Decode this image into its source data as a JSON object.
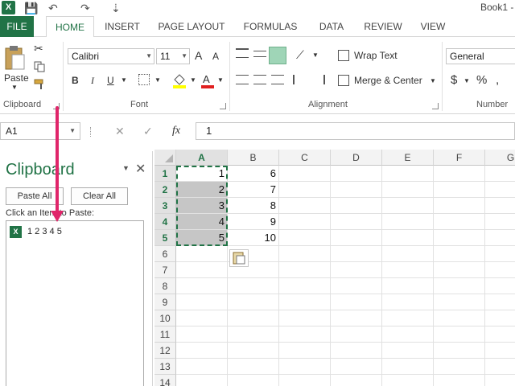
{
  "title_bar": {
    "book_title": "Book1 -",
    "qa_save": "💾",
    "qa_undo": "↶",
    "qa_redo": "↷",
    "qa_more": "⇣"
  },
  "tabs": [
    "FILE",
    "HOME",
    "INSERT",
    "PAGE LAYOUT",
    "FORMULAS",
    "DATA",
    "REVIEW",
    "VIEW"
  ],
  "clipboard_group": {
    "paste_label": "Paste",
    "group_label": "Clipboard"
  },
  "font_group": {
    "font_name": "Calibri",
    "font_size": "11",
    "bold": "B",
    "italic": "I",
    "underline": "U",
    "group_label": "Font",
    "grow": "A",
    "shrink": "A"
  },
  "alignment_group": {
    "wrap_text": "Wrap Text",
    "merge_center": "Merge & Center",
    "group_label": "Alignment"
  },
  "number_group": {
    "format": "General",
    "currency": "$",
    "percent": "%",
    "group_label": "Number"
  },
  "formula_bar": {
    "name_box": "A1",
    "cancel": "✕",
    "enter": "✓",
    "fx": "fx",
    "value": "1"
  },
  "clipboard_pane": {
    "title": "Clipboard",
    "paste_all": "Paste All",
    "clear_all": "Clear All",
    "instruction": "Click an Item to Paste:",
    "items": [
      {
        "text": "1 2 3 4 5",
        "icon": "excel-icon"
      }
    ]
  },
  "sheet": {
    "columns": [
      "A",
      "B",
      "C",
      "D",
      "E",
      "F",
      "G"
    ],
    "rows": [
      "1",
      "2",
      "3",
      "4",
      "5",
      "6",
      "7",
      "8",
      "9",
      "10",
      "11",
      "12",
      "13",
      "14"
    ],
    "cells": {
      "A": [
        "1",
        "2",
        "3",
        "4",
        "5"
      ],
      "B": [
        "6",
        "7",
        "8",
        "9",
        "10"
      ]
    }
  },
  "colors": {
    "accent": "#217346",
    "arrow": "#e0256a"
  }
}
